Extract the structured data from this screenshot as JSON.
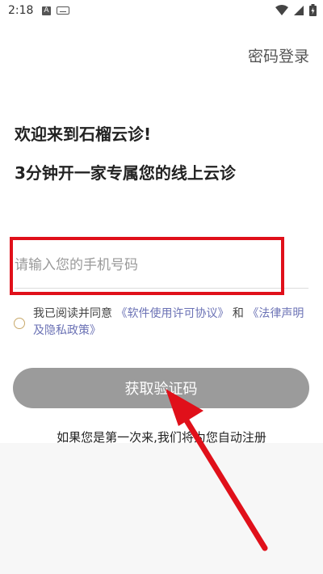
{
  "status_bar": {
    "time": "2:18",
    "notif_letter": "A"
  },
  "header": {
    "password_login": "密码登录"
  },
  "welcome": {
    "title": "欢迎来到石榴云诊!",
    "subtitle": "3分钟开一家专属您的线上云诊"
  },
  "phone": {
    "placeholder": "请输入您的手机号码",
    "value": ""
  },
  "agreement": {
    "prefix": "我已阅读并同意",
    "license": "《软件使用许可协议》",
    "and": "和",
    "legal": "《法律声明及隐私政策》"
  },
  "buttons": {
    "get_code": "获取验证码"
  },
  "footer": {
    "auto_register": "如果您是第一次来,我们将为您自动注册"
  },
  "colors": {
    "button_bg": "#9b9b9b",
    "link": "#6b72b5",
    "annotation": "#e0101a"
  }
}
